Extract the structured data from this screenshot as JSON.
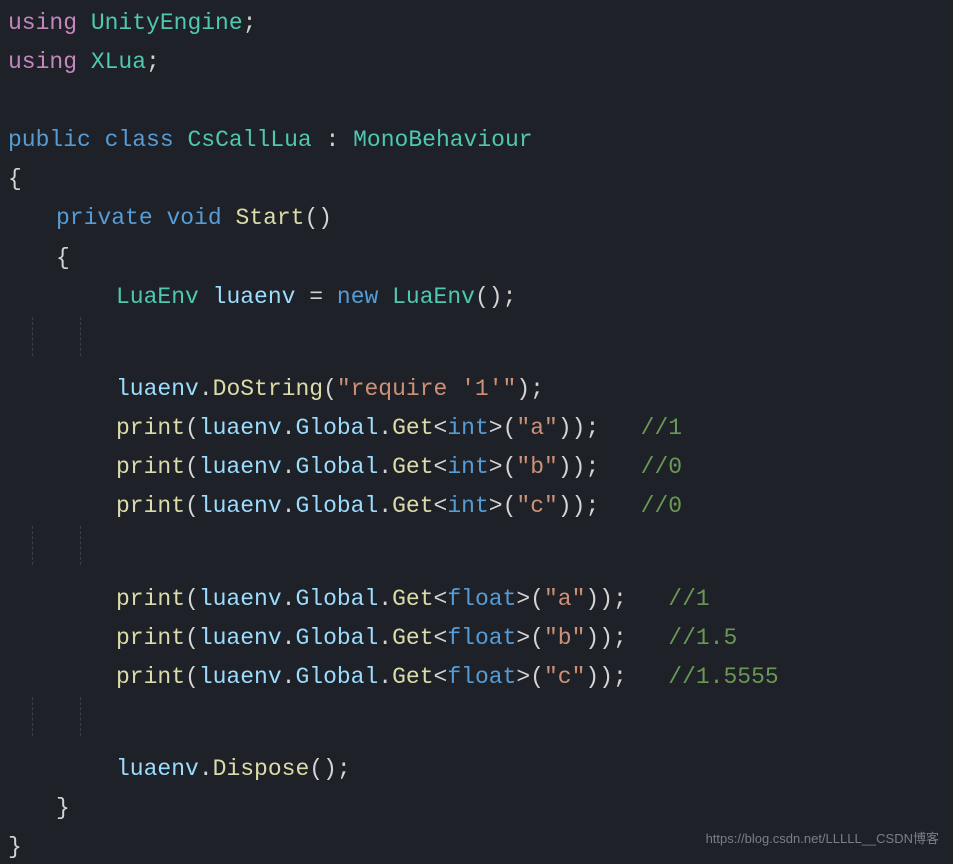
{
  "code": {
    "using1_kw": "using",
    "using1_ns": "UnityEngine",
    "using2_kw": "using",
    "using2_ns": "XLua",
    "public_kw": "public",
    "class_kw": "class",
    "class_name": "CsCallLua",
    "colon": " : ",
    "base_class": "MonoBehaviour",
    "brace_open": "{",
    "brace_close": "}",
    "private_kw": "private",
    "void_kw": "void",
    "method_name": "Start",
    "parens": "()",
    "luaenv_type": "LuaEnv",
    "luaenv_var": "luaenv",
    "equals": " = ",
    "new_kw": "new",
    "dostring": "DoString",
    "require_str": "\"require '1'\"",
    "print": "print",
    "global": "Global",
    "get": "Get",
    "int_type": "int",
    "float_type": "float",
    "str_a": "\"a\"",
    "str_b": "\"b\"",
    "str_c": "\"c\"",
    "c1": "//1",
    "c0": "//0",
    "c15": "//1.5",
    "c15555": "//1.5555",
    "dispose": "Dispose",
    "semi": ";",
    "dot": ".",
    "lt": "<",
    "gt": ">",
    "lp": "(",
    "rp": ")"
  },
  "watermark": "https://blog.csdn.net/LLLLL__CSDN博客"
}
